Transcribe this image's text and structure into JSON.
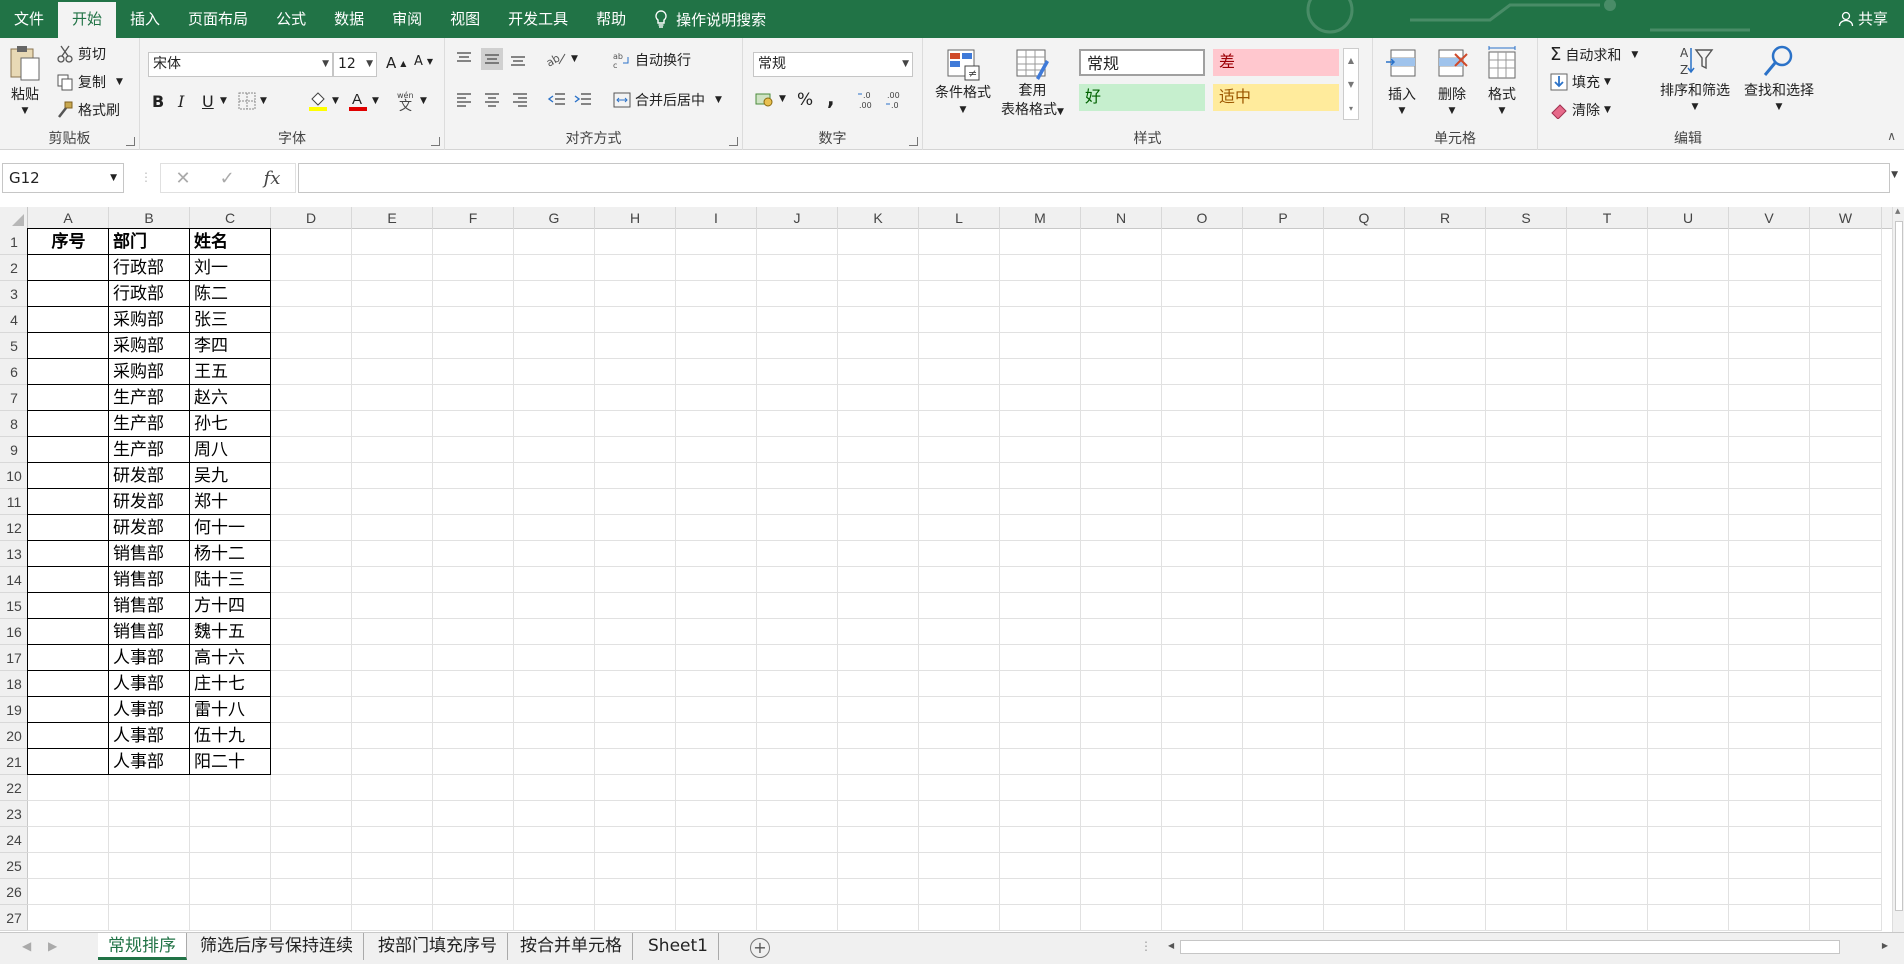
{
  "menu": {
    "tabs": [
      "文件",
      "开始",
      "插入",
      "页面布局",
      "公式",
      "数据",
      "审阅",
      "视图",
      "开发工具",
      "帮助"
    ],
    "active_index": 1,
    "search_label": "操作说明搜索",
    "share_label": "共享"
  },
  "ribbon": {
    "clipboard": {
      "paste": "粘贴",
      "cut": "剪切",
      "copy": "复制",
      "format_painter": "格式刷",
      "label": "剪贴板"
    },
    "font": {
      "name": "宋体",
      "size": "12",
      "label": "字体",
      "bold": "B",
      "italic": "I",
      "underline": "U"
    },
    "alignment": {
      "wrap": "自动换行",
      "merge": "合并后居中",
      "label": "对齐方式"
    },
    "number": {
      "format": "常规",
      "percent": "%",
      "comma": ",",
      "label": "数字"
    },
    "styles": {
      "conditional": "条件格式",
      "table_line1": "套用",
      "table_line2": "表格格式",
      "normal": "常规",
      "bad": "差",
      "good": "好",
      "neutral": "适中",
      "label": "样式"
    },
    "cells": {
      "insert": "插入",
      "delete": "删除",
      "format": "格式",
      "label": "单元格"
    },
    "editing": {
      "autosum": "自动求和",
      "fill": "填充",
      "clear": "清除",
      "sort": "排序和筛选",
      "find": "查找和选择",
      "label": "编辑"
    }
  },
  "formula": {
    "name_box": "G12",
    "fx": "fx",
    "content": ""
  },
  "columns": [
    "A",
    "B",
    "C",
    "D",
    "E",
    "F",
    "G",
    "H",
    "I",
    "J",
    "K",
    "L",
    "M",
    "N",
    "O",
    "P",
    "Q",
    "R",
    "S",
    "T",
    "U",
    "V",
    "W"
  ],
  "rows": [
    "1",
    "2",
    "3",
    "4",
    "5",
    "6",
    "7",
    "8",
    "9",
    "10",
    "11",
    "12",
    "13",
    "14",
    "15",
    "16",
    "17",
    "18",
    "19",
    "20",
    "21",
    "22",
    "23",
    "24",
    "25",
    "26",
    "27"
  ],
  "table": {
    "headers": [
      "序号",
      "部门",
      "姓名"
    ],
    "rows": [
      [
        "",
        "行政部",
        "刘一"
      ],
      [
        "",
        "行政部",
        "陈二"
      ],
      [
        "",
        "采购部",
        "张三"
      ],
      [
        "",
        "采购部",
        "李四"
      ],
      [
        "",
        "采购部",
        "王五"
      ],
      [
        "",
        "生产部",
        "赵六"
      ],
      [
        "",
        "生产部",
        "孙七"
      ],
      [
        "",
        "生产部",
        "周八"
      ],
      [
        "",
        "研发部",
        "吴九"
      ],
      [
        "",
        "研发部",
        "郑十"
      ],
      [
        "",
        "研发部",
        "何十一"
      ],
      [
        "",
        "销售部",
        "杨十二"
      ],
      [
        "",
        "销售部",
        "陆十三"
      ],
      [
        "",
        "销售部",
        "方十四"
      ],
      [
        "",
        "销售部",
        "魏十五"
      ],
      [
        "",
        "人事部",
        "高十六"
      ],
      [
        "",
        "人事部",
        "庄十七"
      ],
      [
        "",
        "人事部",
        "雷十八"
      ],
      [
        "",
        "人事部",
        "伍十九"
      ],
      [
        "",
        "人事部",
        "阳二十"
      ]
    ]
  },
  "sheets": {
    "tabs": [
      "常规排序",
      "筛选后序号保持连续",
      "按部门填充序号",
      "按合并单元格",
      "Sheet1"
    ],
    "active_index": 0
  },
  "colors": {
    "brand": "#217346",
    "bad_bg": "#ffc7ce",
    "bad_fg": "#9c0006",
    "good_bg": "#c6efce",
    "good_fg": "#006100",
    "neutral_bg": "#ffeb9c",
    "neutral_fg": "#9c5700"
  }
}
